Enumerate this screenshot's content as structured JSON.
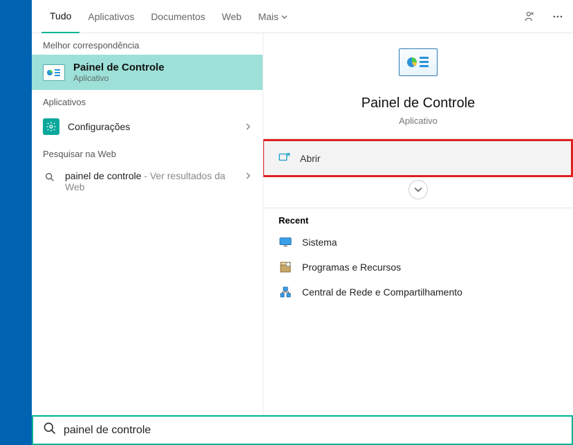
{
  "tabs": {
    "all": "Tudo",
    "apps": "Aplicativos",
    "docs": "Documentos",
    "web": "Web",
    "more": "Mais"
  },
  "left": {
    "best_match_label": "Melhor correspondência",
    "best": {
      "title": "Painel de Controle",
      "subtitle": "Aplicativo"
    },
    "apps_label": "Aplicativos",
    "settings_label": "Configurações",
    "web_label": "Pesquisar na Web",
    "web_item": {
      "query": "painel de controle",
      "suffix": " - Ver resultados da Web"
    }
  },
  "right": {
    "hero_title": "Painel de Controle",
    "hero_sub": "Aplicativo",
    "open_label": "Abrir",
    "recent_label": "Recent",
    "recent": {
      "r0": "Sistema",
      "r1": "Programas e Recursos",
      "r2": "Central de Rede e Compartilhamento"
    }
  },
  "search": {
    "value": "painel de controle"
  }
}
